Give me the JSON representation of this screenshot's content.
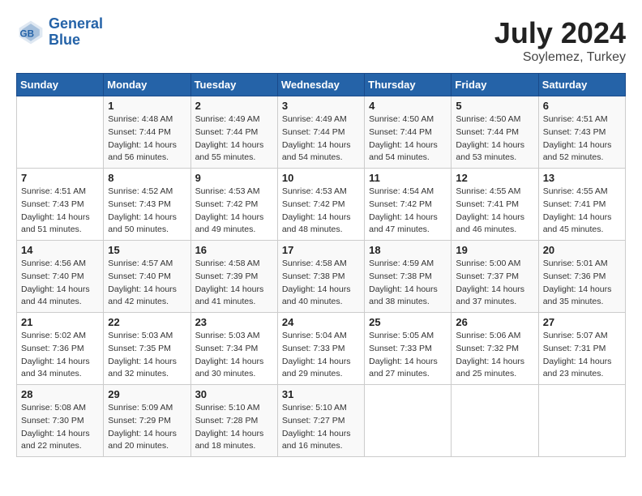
{
  "header": {
    "logo_line1": "General",
    "logo_line2": "Blue",
    "title": "July 2024",
    "subtitle": "Soylemez, Turkey"
  },
  "weekdays": [
    "Sunday",
    "Monday",
    "Tuesday",
    "Wednesday",
    "Thursday",
    "Friday",
    "Saturday"
  ],
  "weeks": [
    [
      {
        "day": "",
        "info": ""
      },
      {
        "day": "1",
        "info": "Sunrise: 4:48 AM\nSunset: 7:44 PM\nDaylight: 14 hours\nand 56 minutes."
      },
      {
        "day": "2",
        "info": "Sunrise: 4:49 AM\nSunset: 7:44 PM\nDaylight: 14 hours\nand 55 minutes."
      },
      {
        "day": "3",
        "info": "Sunrise: 4:49 AM\nSunset: 7:44 PM\nDaylight: 14 hours\nand 54 minutes."
      },
      {
        "day": "4",
        "info": "Sunrise: 4:50 AM\nSunset: 7:44 PM\nDaylight: 14 hours\nand 54 minutes."
      },
      {
        "day": "5",
        "info": "Sunrise: 4:50 AM\nSunset: 7:44 PM\nDaylight: 14 hours\nand 53 minutes."
      },
      {
        "day": "6",
        "info": "Sunrise: 4:51 AM\nSunset: 7:43 PM\nDaylight: 14 hours\nand 52 minutes."
      }
    ],
    [
      {
        "day": "7",
        "info": "Sunrise: 4:51 AM\nSunset: 7:43 PM\nDaylight: 14 hours\nand 51 minutes."
      },
      {
        "day": "8",
        "info": "Sunrise: 4:52 AM\nSunset: 7:43 PM\nDaylight: 14 hours\nand 50 minutes."
      },
      {
        "day": "9",
        "info": "Sunrise: 4:53 AM\nSunset: 7:42 PM\nDaylight: 14 hours\nand 49 minutes."
      },
      {
        "day": "10",
        "info": "Sunrise: 4:53 AM\nSunset: 7:42 PM\nDaylight: 14 hours\nand 48 minutes."
      },
      {
        "day": "11",
        "info": "Sunrise: 4:54 AM\nSunset: 7:42 PM\nDaylight: 14 hours\nand 47 minutes."
      },
      {
        "day": "12",
        "info": "Sunrise: 4:55 AM\nSunset: 7:41 PM\nDaylight: 14 hours\nand 46 minutes."
      },
      {
        "day": "13",
        "info": "Sunrise: 4:55 AM\nSunset: 7:41 PM\nDaylight: 14 hours\nand 45 minutes."
      }
    ],
    [
      {
        "day": "14",
        "info": "Sunrise: 4:56 AM\nSunset: 7:40 PM\nDaylight: 14 hours\nand 44 minutes."
      },
      {
        "day": "15",
        "info": "Sunrise: 4:57 AM\nSunset: 7:40 PM\nDaylight: 14 hours\nand 42 minutes."
      },
      {
        "day": "16",
        "info": "Sunrise: 4:58 AM\nSunset: 7:39 PM\nDaylight: 14 hours\nand 41 minutes."
      },
      {
        "day": "17",
        "info": "Sunrise: 4:58 AM\nSunset: 7:38 PM\nDaylight: 14 hours\nand 40 minutes."
      },
      {
        "day": "18",
        "info": "Sunrise: 4:59 AM\nSunset: 7:38 PM\nDaylight: 14 hours\nand 38 minutes."
      },
      {
        "day": "19",
        "info": "Sunrise: 5:00 AM\nSunset: 7:37 PM\nDaylight: 14 hours\nand 37 minutes."
      },
      {
        "day": "20",
        "info": "Sunrise: 5:01 AM\nSunset: 7:36 PM\nDaylight: 14 hours\nand 35 minutes."
      }
    ],
    [
      {
        "day": "21",
        "info": "Sunrise: 5:02 AM\nSunset: 7:36 PM\nDaylight: 14 hours\nand 34 minutes."
      },
      {
        "day": "22",
        "info": "Sunrise: 5:03 AM\nSunset: 7:35 PM\nDaylight: 14 hours\nand 32 minutes."
      },
      {
        "day": "23",
        "info": "Sunrise: 5:03 AM\nSunset: 7:34 PM\nDaylight: 14 hours\nand 30 minutes."
      },
      {
        "day": "24",
        "info": "Sunrise: 5:04 AM\nSunset: 7:33 PM\nDaylight: 14 hours\nand 29 minutes."
      },
      {
        "day": "25",
        "info": "Sunrise: 5:05 AM\nSunset: 7:33 PM\nDaylight: 14 hours\nand 27 minutes."
      },
      {
        "day": "26",
        "info": "Sunrise: 5:06 AM\nSunset: 7:32 PM\nDaylight: 14 hours\nand 25 minutes."
      },
      {
        "day": "27",
        "info": "Sunrise: 5:07 AM\nSunset: 7:31 PM\nDaylight: 14 hours\nand 23 minutes."
      }
    ],
    [
      {
        "day": "28",
        "info": "Sunrise: 5:08 AM\nSunset: 7:30 PM\nDaylight: 14 hours\nand 22 minutes."
      },
      {
        "day": "29",
        "info": "Sunrise: 5:09 AM\nSunset: 7:29 PM\nDaylight: 14 hours\nand 20 minutes."
      },
      {
        "day": "30",
        "info": "Sunrise: 5:10 AM\nSunset: 7:28 PM\nDaylight: 14 hours\nand 18 minutes."
      },
      {
        "day": "31",
        "info": "Sunrise: 5:10 AM\nSunset: 7:27 PM\nDaylight: 14 hours\nand 16 minutes."
      },
      {
        "day": "",
        "info": ""
      },
      {
        "day": "",
        "info": ""
      },
      {
        "day": "",
        "info": ""
      }
    ]
  ]
}
